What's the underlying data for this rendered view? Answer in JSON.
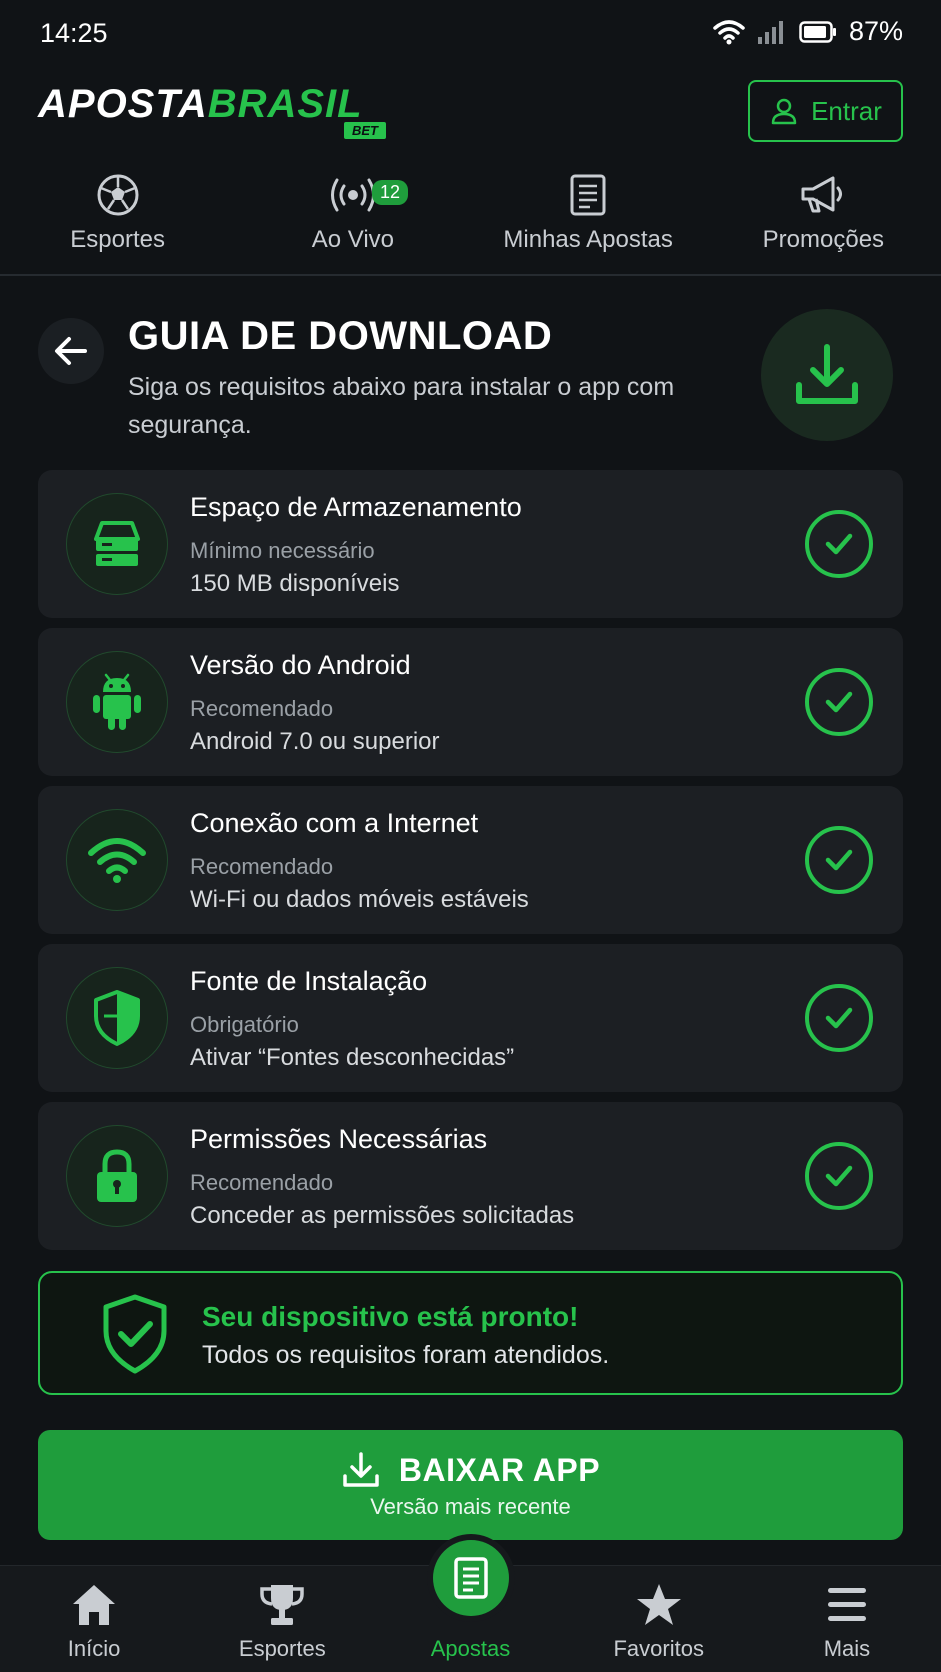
{
  "status": {
    "time": "14:25",
    "battery": "87%"
  },
  "header": {
    "logo_part1": "APOSTA",
    "logo_part2": "BRASIL",
    "logo_badge": "BET",
    "login_label": "Entrar"
  },
  "topnav": {
    "items": [
      {
        "label": "Esportes",
        "icon": "soccer-ball-icon"
      },
      {
        "label": "Ao Vivo",
        "icon": "live-broadcast-icon",
        "badge": "12"
      },
      {
        "label": "Minhas Apostas",
        "icon": "receipt-icon"
      },
      {
        "label": "Promoções",
        "icon": "megaphone-icon"
      }
    ]
  },
  "page": {
    "title": "GUIA DE DOWNLOAD",
    "subtitle": "Siga os requisitos abaixo para instalar o app com segurança."
  },
  "requirements": [
    {
      "title_a": "Espaço de ",
      "title_b": "Armazenamento",
      "sub": "Mínimo necessário",
      "value_a": "150 MB",
      "value_b": " disponíveis",
      "icon": "storage-drive-icon"
    },
    {
      "title_a": "Versão do ",
      "title_b": "Android",
      "sub": "Recomendado",
      "value_a": "Android 7.0",
      "value_b": " ou superior",
      "icon": "android-icon"
    },
    {
      "title_a": "Conexão ",
      "title_b": "com a Internet",
      "sub": "Recomendado",
      "value_a": "Wi-Fi",
      "value_b": " ou dados móveis estáveis",
      "icon": "wifi-icon"
    },
    {
      "title_a": "Fonte de ",
      "title_b": "Instalação",
      "sub": "Obrigatório",
      "value_a": "Ativar “Fontes desconhecidas”",
      "value_b": "",
      "icon": "shield-icon"
    },
    {
      "title_a": "Permissões Necessárias",
      "title_b": "",
      "sub": "Recomendado",
      "value_a": "Conceder as permissões solicitadas",
      "value_b": "",
      "icon": "lock-icon"
    }
  ],
  "ready": {
    "title": "Seu dispositivo está pronto!",
    "text": "Todos os requisitos foram atendidos."
  },
  "download_button": {
    "label": "BAIXAR APP",
    "sub": "Versão mais recente"
  },
  "bottomnav": {
    "items": [
      {
        "label": "Início",
        "icon": "home-icon"
      },
      {
        "label": "Esportes",
        "icon": "trophy-icon"
      },
      {
        "label": "Apostas",
        "icon": "bet-slip-icon",
        "active": true
      },
      {
        "label": "Favoritos",
        "icon": "star-icon"
      },
      {
        "label": "Mais",
        "icon": "menu-icon"
      }
    ]
  },
  "colors": {
    "accent": "#27c24c",
    "button": "#1f9d3c",
    "background": "#101316",
    "card": "#1c1f23"
  }
}
